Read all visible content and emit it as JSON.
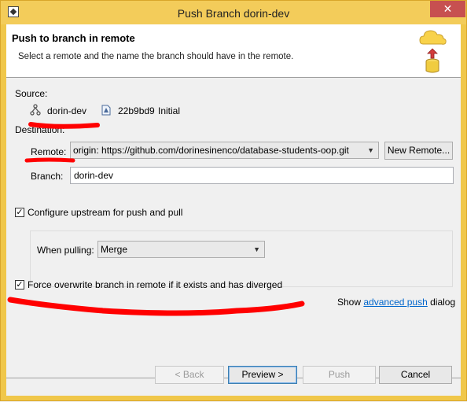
{
  "window": {
    "title": "Push Branch dorin-dev",
    "close_glyph": "✕"
  },
  "banner": {
    "title": "Push to branch in remote",
    "description": "Select a remote and the name the branch should have in the remote.",
    "icon": "cloud-upload-database-icon"
  },
  "source": {
    "label": "Source:",
    "branch": "dorin-dev",
    "commit_id": "22b9bd9",
    "commit_message": "Initial"
  },
  "destination": {
    "label": "Destination:",
    "remote_label": "Remote:",
    "remote_value": "origin: https://github.com/dorinesinenco/database-students-oop.git",
    "new_remote_button": "New Remote...",
    "branch_label": "Branch:",
    "branch_value": "dorin-dev"
  },
  "upstream": {
    "checked": true,
    "label": "Configure upstream for push and pull",
    "when_pulling_label": "When pulling:",
    "when_pulling_value": "Merge"
  },
  "force": {
    "checked": true,
    "label": "Force overwrite branch in remote if it exists and has diverged"
  },
  "advanced": {
    "prefix": "Show",
    "link": "advanced push",
    "suffix": "dialog"
  },
  "buttons": {
    "back": "< Back",
    "preview": "Preview >",
    "push": "Push",
    "cancel": "Cancel"
  },
  "annotation_color": "#ff0000"
}
